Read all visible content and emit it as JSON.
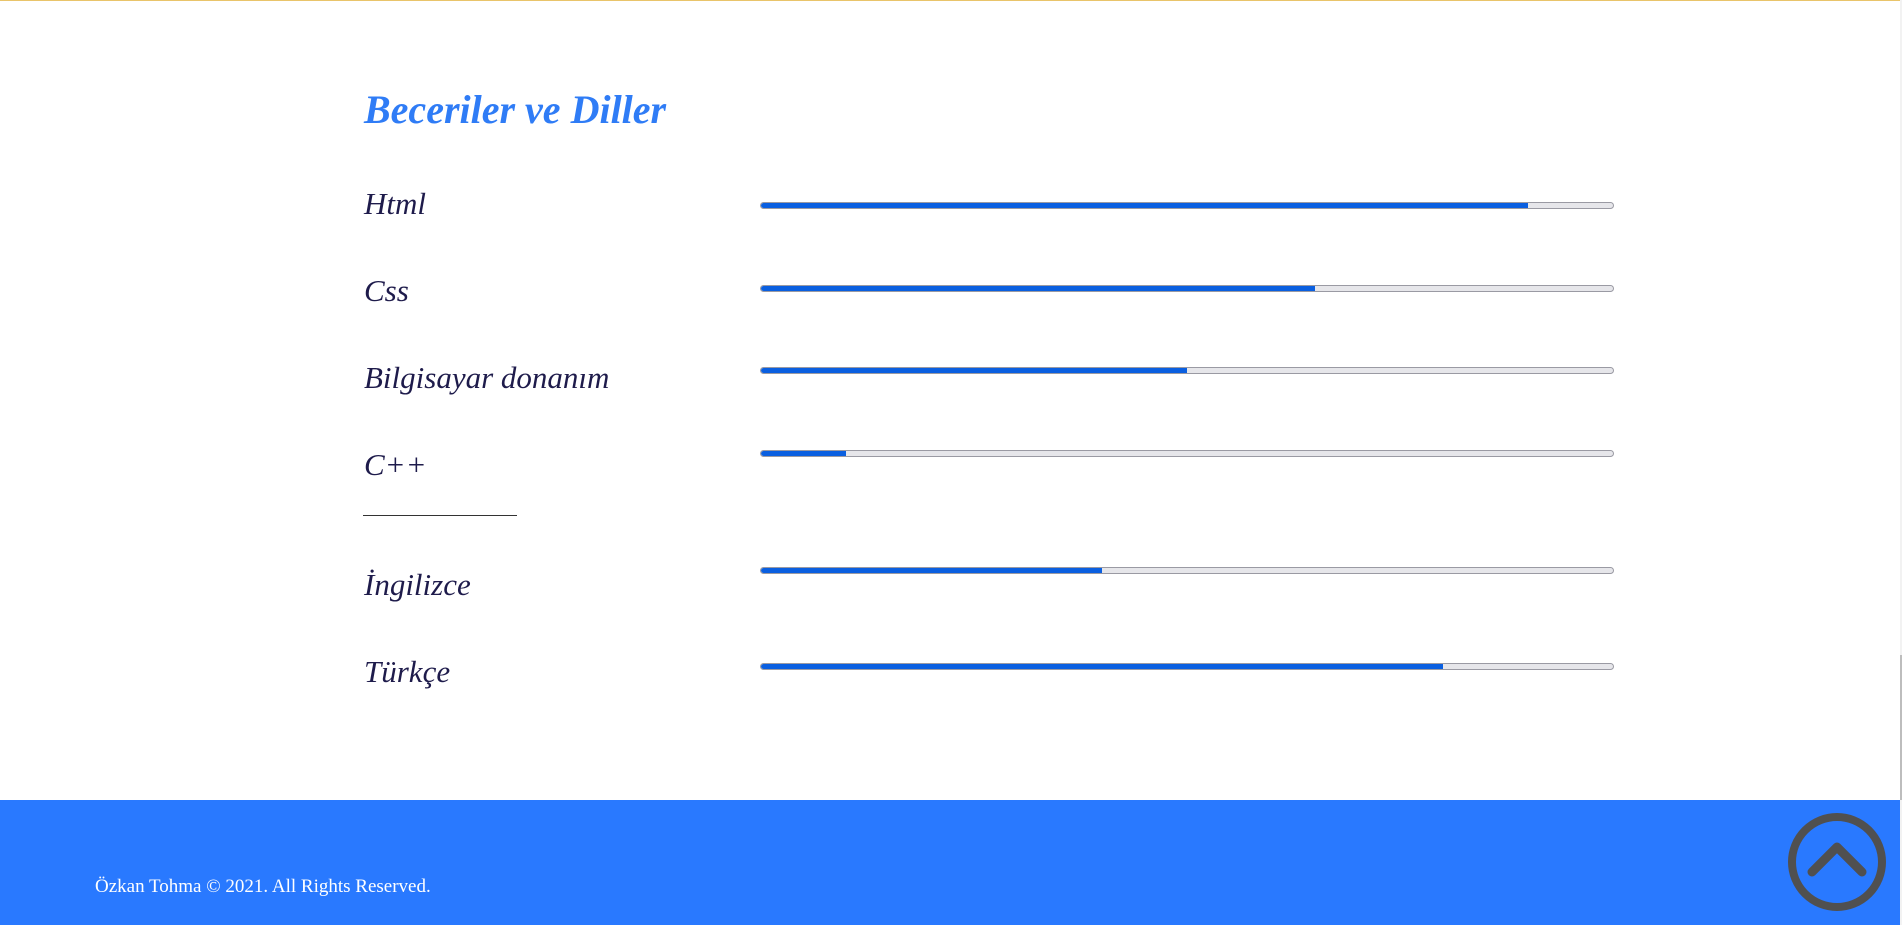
{
  "skills_section": {
    "title": "Beceriler ve Diller",
    "skills": [
      {
        "label": "Html",
        "level": 0.9
      },
      {
        "label": "Css",
        "level": 0.65
      },
      {
        "label": "Bilgisayar donanım",
        "level": 0.5
      },
      {
        "label": "C++",
        "level": 0.1
      }
    ],
    "languages": [
      {
        "label": "İngilizce",
        "level": 0.4
      },
      {
        "label": "Türkçe",
        "level": 0.8
      }
    ]
  },
  "footer": {
    "copyright": "Özkan Tohma © 2021. All Rights Reserved."
  },
  "icons": {
    "back_to_top": "chevron-up-circle-icon"
  },
  "colors": {
    "accent": "#2979ff",
    "title": "#2f7cf6",
    "bar_fill": "#0a5fe0",
    "label_text": "#1e1b4b"
  }
}
